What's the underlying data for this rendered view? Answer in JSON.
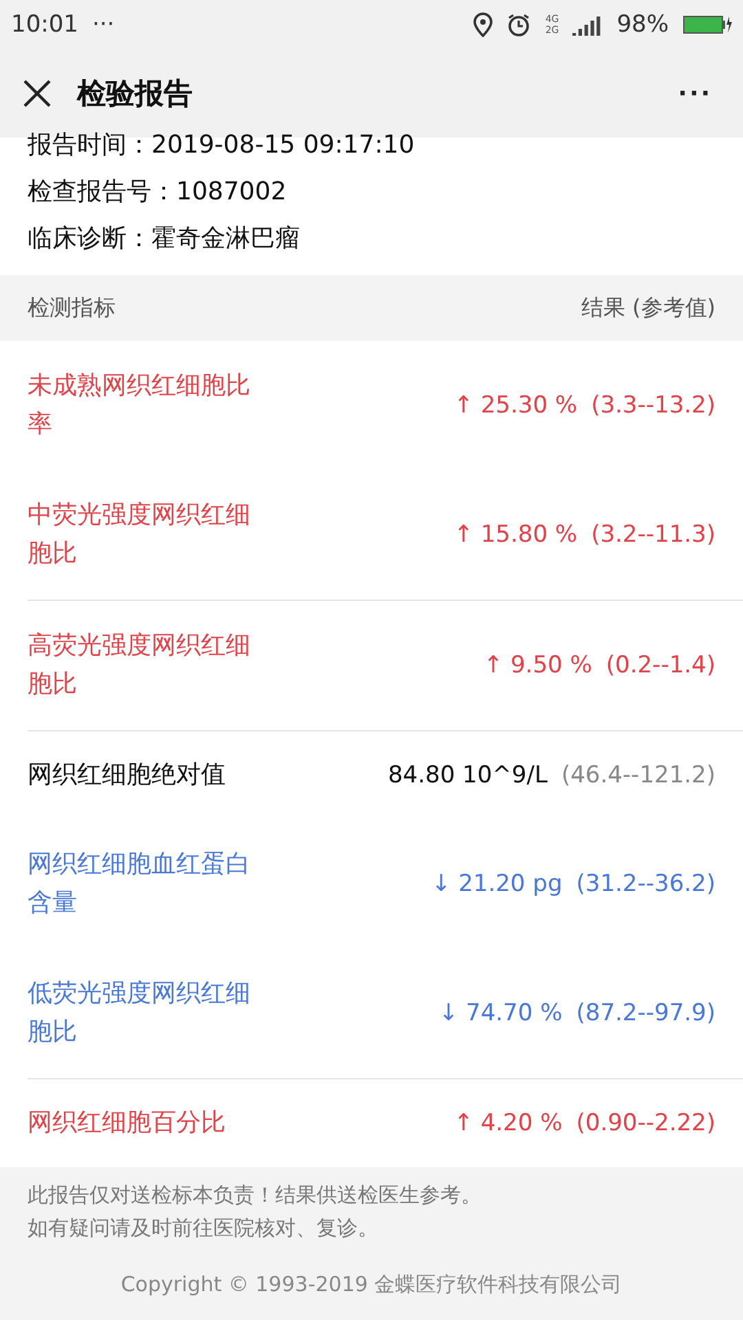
{
  "status_bar": {
    "time": "10:01",
    "dots": "···",
    "network_top": "4G",
    "network_bottom": "2G",
    "battery": "98%"
  },
  "header": {
    "title": "检验报告",
    "menu": "···"
  },
  "info": [
    {
      "label": "报告时间：",
      "value": "2019-08-15 09:17:10"
    },
    {
      "label": "检查报告号：",
      "value": "1087002"
    },
    {
      "label": "临床诊断：",
      "value": "霍奇金淋巴瘤"
    }
  ],
  "table": {
    "columns": [
      "检测指标",
      "结果 (参考值)"
    ],
    "rows": [
      {
        "name": "未成熟网织红细胞比率",
        "color": "#e0434a",
        "result": "↑ 25.30 %",
        "range": "(3.3--13.2)",
        "divider": false
      },
      {
        "name": "中荧光强度网织红细胞比",
        "color": "#e0434a",
        "result": "↑ 15.80 %",
        "range": "(3.2--11.3)",
        "divider": false
      },
      {
        "name": "高荧光强度网织红细胞比",
        "color": "#e0434a",
        "result": "↑ 9.50 %",
        "range": "(0.2--1.4)",
        "divider": true
      },
      {
        "name": "网织红细胞绝对值",
        "color": "#111111",
        "result": "84.80 10^9/L",
        "range": "(46.4--121.2)",
        "divider": true
      },
      {
        "name": "网织红细胞血红蛋白含量",
        "color": "#4a78d6",
        "result": "↓ 21.20 pg",
        "range": "(31.2--36.2)",
        "divider": false
      },
      {
        "name": "低荧光强度网织红细胞比",
        "color": "#4a78d6",
        "result": "↓ 74.70 %",
        "range": "(87.2--97.9)",
        "divider": false
      },
      {
        "name": "网织红细胞百分比",
        "color": "#e0434a",
        "result": "↑ 4.20 %",
        "range": "(0.90--2.22)",
        "divider": true
      }
    ]
  },
  "footer": {
    "notes": [
      "此报告仅对送检标本负责！结果供送检医生参考。",
      "如有疑问请及时前往医院核对、复诊。"
    ],
    "copyright": "Copyright © 1993-2019 金蝶医疗软件科技有限公司"
  }
}
